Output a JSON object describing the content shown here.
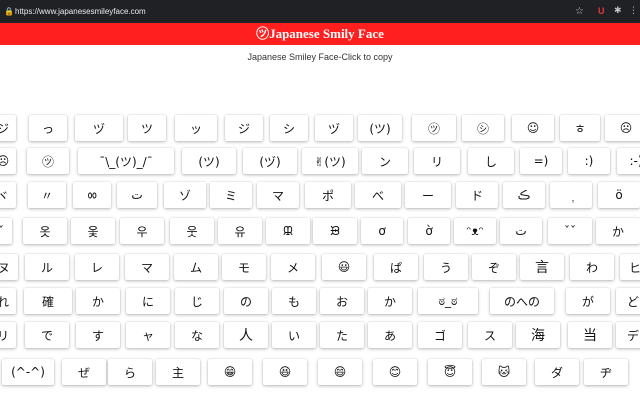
{
  "browser": {
    "url": "https://www.japanesesmileyface.com",
    "icons": {
      "lock": "lock-icon",
      "star": "star-icon",
      "ext1": "ublock-extension-icon",
      "ext2": "puzzle-extensions-icon",
      "menu": "kebab-menu-icon"
    }
  },
  "header": {
    "title": "㋡Japanese Smily Face"
  },
  "subtitle": "Japanese Smiley Face-Click to copy",
  "colors": {
    "header_bg": "#ff1f1f",
    "chrome_bg": "#202124"
  },
  "rows": [
    [
      "ジ",
      "っ",
      "ヅ",
      "ツ",
      "ッ",
      "ジ",
      "シ",
      "ヅ",
      "(ツ)",
      "㋡",
      "㋛",
      "☺",
      "ㅎ",
      "☹"
    ],
    [
      "☹",
      "㋡",
      "¯\\_(ツ)_/¯",
      "(ツ)",
      "(ヅ)",
      "✌(ツ)",
      "ン",
      "リ",
      "し",
      "=)",
      ":)",
      ":-)"
    ],
    [
      "ヾ",
      "〃",
      "ㆀ",
      "ت",
      "ゾ",
      "ミ",
      "マ",
      "ポ",
      "べ",
      "ー",
      "ド",
      "ڪ",
      "ٜٜ",
      "ö"
    ],
    [
      "ˇ",
      "옷",
      "옻",
      "우",
      "웃",
      "유",
      "ᙜ",
      "ᙗ",
      "ơ",
      "ờ",
      "ᵔᴥᵔ",
      "ت",
      "ˇˇ",
      "か"
    ],
    [
      "ヌ",
      "ル",
      "レ",
      "マ",
      "ム",
      "モ",
      "メ",
      "😃",
      "ぱ",
      "う",
      "ぞ",
      "言",
      "わ",
      "ヒ"
    ],
    [
      "れ",
      "確",
      "か",
      "に",
      "じ",
      "の",
      "も",
      "お",
      "か",
      "ಠ_ಠ",
      "のへの",
      "が",
      "ど"
    ],
    [
      "リ",
      "で",
      "す",
      "ャ",
      "な",
      "人",
      "い",
      "た",
      "あ",
      "ゴ",
      "ス",
      "海",
      "当",
      "デ"
    ],
    [
      "(^-^)",
      "ぜ",
      "ら",
      "主",
      "😁",
      "😆",
      "😄",
      "😊",
      "😇",
      "🐱",
      "ダ",
      "ヂ"
    ]
  ]
}
